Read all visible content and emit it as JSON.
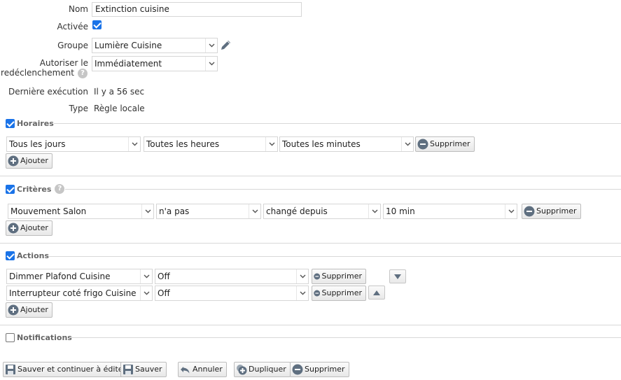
{
  "form": {
    "name_label": "Nom",
    "name_value": "Extinction cuisine",
    "active_label": "Activée",
    "active_checked": true,
    "group_label": "Groupe",
    "group_value": "Lumière Cuisine",
    "retrigger_label_1": "Autoriser le",
    "retrigger_label_2": "redéclenchement",
    "retrigger_value": "Immédiatement",
    "last_exec_label": "Dernière exécution",
    "last_exec_value": "Il y a 56 sec",
    "type_label": "Type",
    "type_value": "Règle locale"
  },
  "schedules": {
    "title": "Horaires",
    "checked": true,
    "row": {
      "days": "Tous les jours",
      "hours": "Toutes les heures",
      "minutes": "Toutes les minutes",
      "delete_label": "Supprimer"
    },
    "add_label": "Ajouter"
  },
  "criteria": {
    "title": "Critères",
    "checked": true,
    "row": {
      "device": "Mouvement Salon",
      "operator": "n'a pas",
      "condition": "changé depuis",
      "duration": "10 min",
      "delete_label": "Supprimer"
    },
    "add_label": "Ajouter"
  },
  "actions": {
    "title": "Actions",
    "checked": true,
    "rows": [
      {
        "device": "Dimmer Plafond Cuisine",
        "value": "Off",
        "delete_label": "Supprimer"
      },
      {
        "device": "Interrupteur coté frigo Cuisine",
        "value": "Off",
        "delete_label": "Supprimer"
      }
    ],
    "add_label": "Ajouter"
  },
  "notifications": {
    "title": "Notifications",
    "checked": false
  },
  "footer": {
    "save_continue": "Sauver et continuer à éditer",
    "save": "Sauver",
    "cancel": "Annuler",
    "duplicate": "Dupliquer",
    "delete": "Supprimer"
  },
  "colors": {
    "accent": "#1a73e8",
    "icon_gray": "#5f6f80",
    "help_gray": "#c6c6c6"
  },
  "icons": [
    "pencil-icon",
    "help-icon",
    "minus-circle-icon",
    "plus-circle-icon",
    "chevron-down-icon",
    "arrow-down-icon",
    "arrow-up-icon",
    "save-icon",
    "undo-icon",
    "duplicate-icon"
  ]
}
